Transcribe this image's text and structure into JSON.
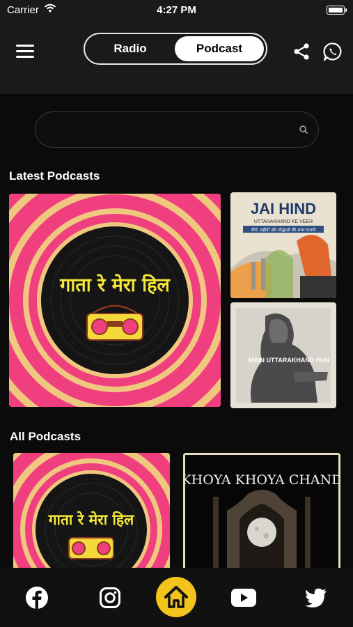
{
  "status_bar": {
    "carrier": "Carrier",
    "time": "4:27 PM"
  },
  "header": {
    "tabs": [
      {
        "label": "Radio",
        "selected": false
      },
      {
        "label": "Podcast",
        "selected": true
      }
    ]
  },
  "search": {
    "placeholder": "",
    "value": ""
  },
  "latest_podcasts": {
    "title": "Latest Podcasts",
    "items": [
      {
        "art_text": "गाता रे मेरा हिल"
      },
      {
        "art_title": "JAI HIND",
        "art_subtitle": "UTTARAKHAND KE VEER",
        "art_tagline": "वीरों, शहीदों और योद्धाओं की अमर गाथायें"
      },
      {
        "art_title": "MAIN UTTARAKHAND HUN"
      }
    ]
  },
  "all_podcasts": {
    "title": "All Podcasts",
    "items": [
      {
        "art_text": "गाता रे मेरा हिल"
      },
      {
        "art_title": "KHOYA KHOYA CHAND"
      }
    ]
  },
  "bottom_nav": [
    "facebook-icon",
    "instagram-icon",
    "home-icon",
    "youtube-icon",
    "twitter-icon"
  ],
  "colors": {
    "background": "#0b0b0b",
    "header": "#1a1a1a",
    "accent": "#f3c21b",
    "pink": "#ef3f7f"
  }
}
